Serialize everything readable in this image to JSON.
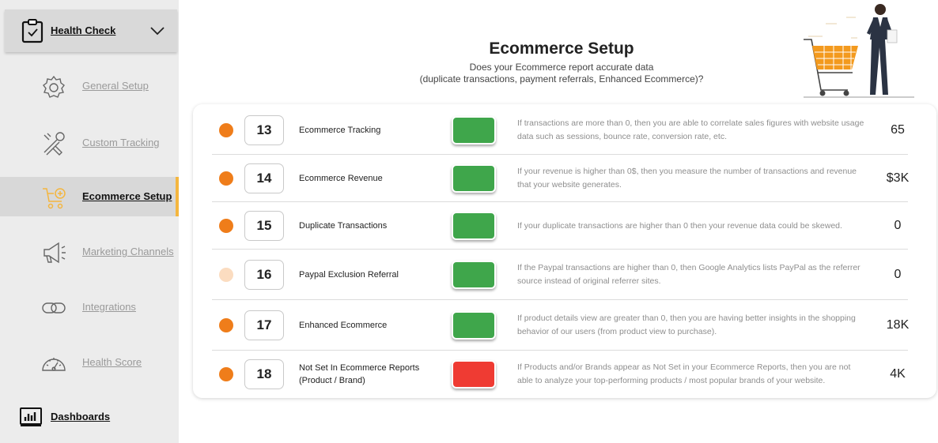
{
  "sidebar": {
    "section": {
      "label": "Health Check",
      "icon": "clipboard-check-icon",
      "toggle_icon": "chevron-down-icon"
    },
    "items": [
      {
        "label": "General Setup",
        "icon": "gear-icon",
        "active": false
      },
      {
        "label": "Custom Tracking",
        "icon": "tools-icon",
        "active": false
      },
      {
        "label": "Ecommerce Setup",
        "icon": "cart-icon",
        "active": true
      },
      {
        "label": "Marketing Channels",
        "icon": "megaphone-icon",
        "active": false
      },
      {
        "label": "Integrations",
        "icon": "link-icon",
        "active": false
      },
      {
        "label": "Health Score",
        "icon": "gauge-icon",
        "active": false
      }
    ],
    "dashboards": {
      "label": "Dashboards",
      "icon": "bar-chart-icon"
    }
  },
  "header": {
    "title": "Ecommerce Setup",
    "subtitle_line1": "Does your Ecommerce report accurate data",
    "subtitle_line2": "(duplicate transactions, payment referrals, Enhanced Ecommerce)?"
  },
  "colors": {
    "accent": "#f4b63f",
    "dot_active": "#ef7d1a",
    "dot_inactive": "#fbdcc0",
    "status_pass": "#3fa64b",
    "status_fail": "#ef3b33"
  },
  "rows": [
    {
      "number": "13",
      "name": "Ecommerce Tracking",
      "status": "pass",
      "dot": "active",
      "description": "If transactions are more than 0, then you are able to correlate sales figures with website usage data such as sessions, bounce rate, conversion rate, etc.",
      "value": "65"
    },
    {
      "number": "14",
      "name": "Ecommerce Revenue",
      "status": "pass",
      "dot": "active",
      "description": "If your revenue is higher than 0$, then you measure the number of transactions and revenue that your website generates.",
      "value": "$3K"
    },
    {
      "number": "15",
      "name": "Duplicate Transactions",
      "status": "pass",
      "dot": "active",
      "description": "If your duplicate transactions are higher than 0 then your revenue data could be skewed.",
      "value": "0"
    },
    {
      "number": "16",
      "name": "Paypal Exclusion Referral",
      "status": "pass",
      "dot": "inactive",
      "description": "If the Paypal transactions are higher than 0, then Google Analytics lists PayPal as the referrer source instead of original referrer sites.",
      "value": "0"
    },
    {
      "number": "17",
      "name": "Enhanced Ecommerce",
      "status": "pass",
      "dot": "active",
      "description": "If product details view are greater than 0, then you are having better insights in the shopping behavior of our users (from product view to purchase).",
      "value": "18K"
    },
    {
      "number": "18",
      "name": "Not Set In Ecommerce Reports (Product / Brand)",
      "status": "fail",
      "dot": "active",
      "description": "If Products and/or Brands appear as Not Set in your Ecommerce Reports, then you are not able to analyze your top-performing products / most popular brands of your website.",
      "value": "4K"
    }
  ]
}
